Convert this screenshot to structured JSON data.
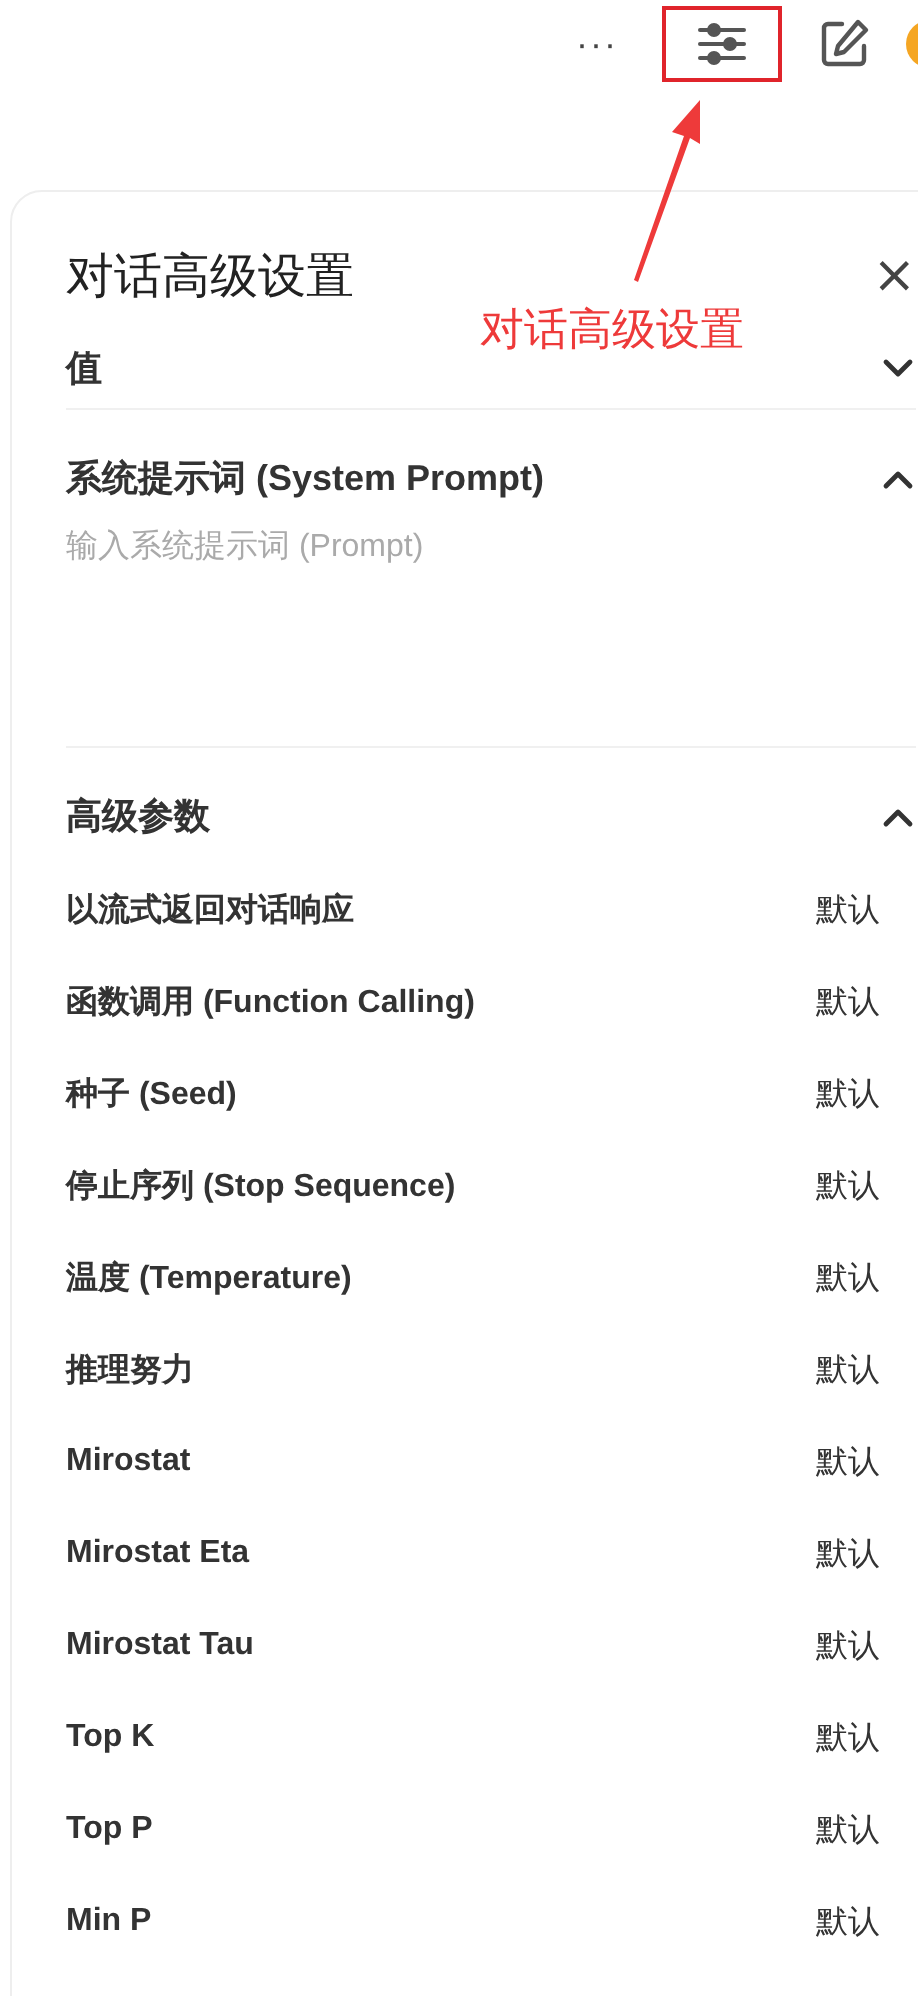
{
  "toolbar": {
    "more": "···"
  },
  "annotation": {
    "text": "对话高级设置"
  },
  "panel": {
    "title": "对话高级设置",
    "close": "×",
    "sections": [
      {
        "kind": "plain",
        "title": "值",
        "expanded": false
      },
      {
        "kind": "prompt",
        "title": "系统提示词 (System Prompt)",
        "expanded": true,
        "placeholder": "输入系统提示词 (Prompt)"
      },
      {
        "kind": "params",
        "title": "高级参数",
        "expanded": true,
        "rows": [
          {
            "label": "以流式返回对话响应",
            "value": "默认"
          },
          {
            "label": "函数调用 (Function Calling)",
            "value": "默认"
          },
          {
            "label": "种子 (Seed)",
            "value": "默认"
          },
          {
            "label": "停止序列 (Stop Sequence)",
            "value": "默认"
          },
          {
            "label": "温度 (Temperature)",
            "value": "默认"
          },
          {
            "label": "推理努力",
            "value": "默认"
          },
          {
            "label": "Mirostat",
            "value": "默认"
          },
          {
            "label": "Mirostat Eta",
            "value": "默认"
          },
          {
            "label": "Mirostat Tau",
            "value": "默认"
          },
          {
            "label": "Top K",
            "value": "默认"
          },
          {
            "label": "Top P",
            "value": "默认"
          },
          {
            "label": "Min P",
            "value": "默认"
          }
        ]
      }
    ]
  }
}
